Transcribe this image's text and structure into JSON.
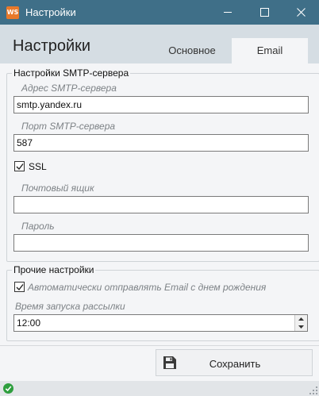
{
  "window": {
    "app_icon_text": "WS",
    "title": "Настройки"
  },
  "header": {
    "title": "Настройки",
    "tabs": [
      {
        "label": "Основное",
        "active": false
      },
      {
        "label": "Email",
        "active": true
      }
    ]
  },
  "smtp_group": {
    "legend": "Настройки SMTP-сервера",
    "server_label": "Адрес SMTP-сервера",
    "server_value": "smtp.yandex.ru",
    "port_label": "Порт SMTP-сервера",
    "port_value": "587",
    "ssl_label": "SSL",
    "ssl_checked": true,
    "mailbox_label": "Почтовый ящик",
    "mailbox_value": "",
    "password_label": "Пароль",
    "password_value": ""
  },
  "other_group": {
    "legend": "Прочие настройки",
    "auto_send_label": "Автоматически отправлять Email с днем рождения",
    "auto_send_checked": true,
    "time_label": "Время запуска рассылки",
    "time_value": "12:00"
  },
  "footer": {
    "save_label": "Сохранить"
  },
  "colors": {
    "titlebar": "#3f6f88",
    "header": "#d5dde3",
    "app_icon": "#e8792a",
    "status_ok": "#2e9e3e"
  },
  "icons": {
    "app": "ws-logo-icon",
    "save": "floppy-disk-icon",
    "status": "check-circle-icon"
  }
}
